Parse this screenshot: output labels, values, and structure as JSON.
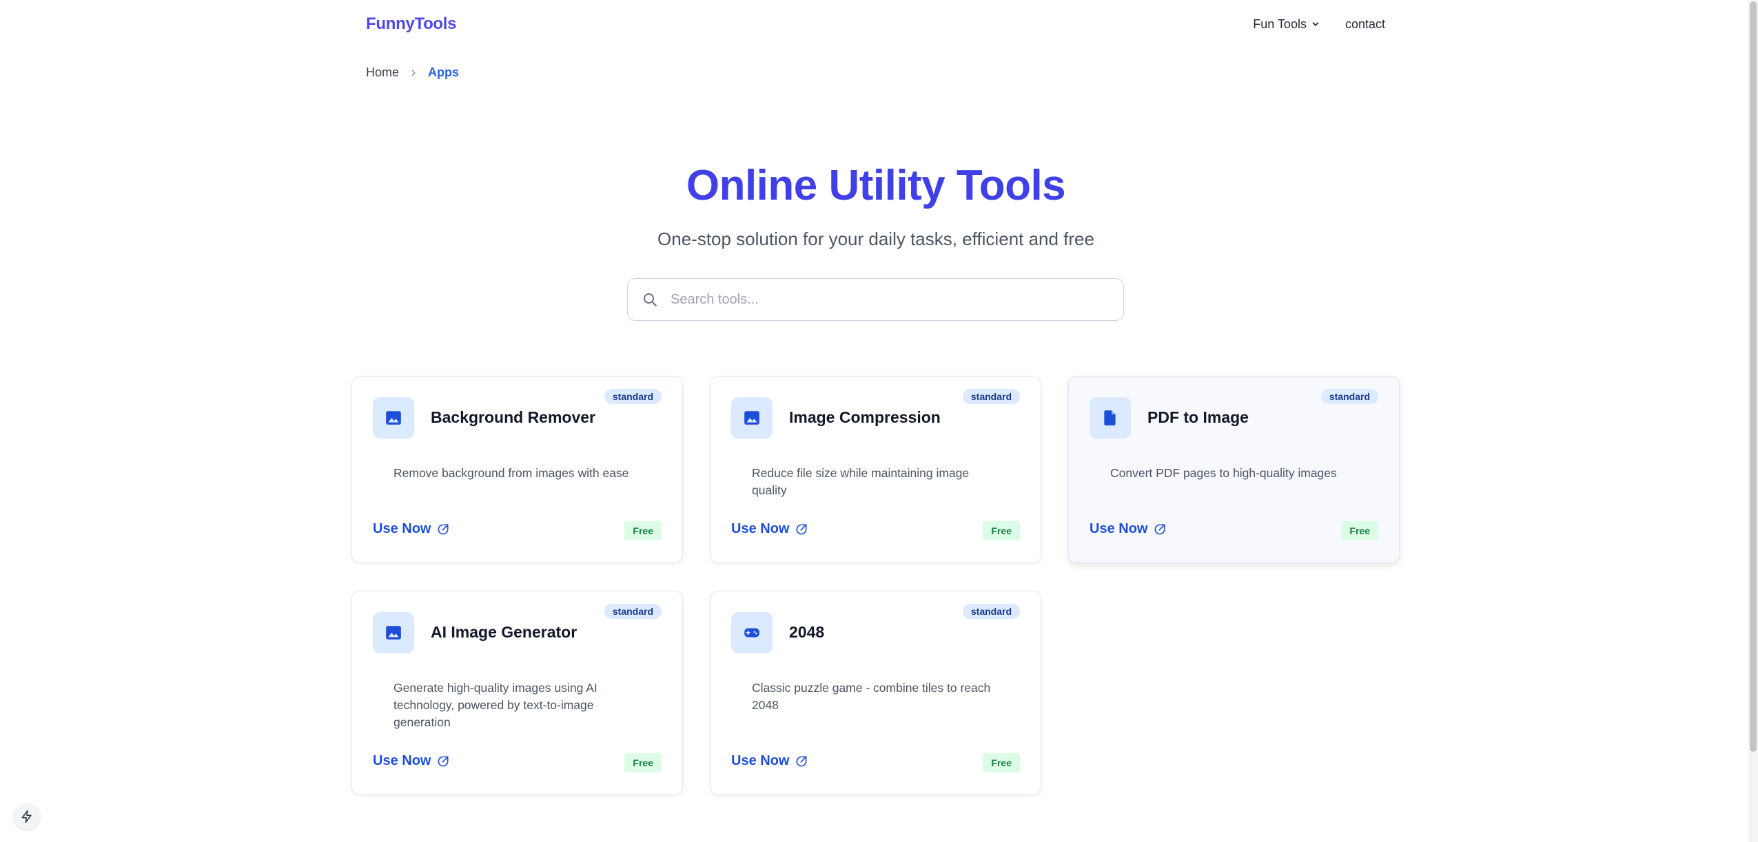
{
  "header": {
    "logo": "FunnyTools",
    "nav": {
      "fun_tools": "Fun Tools",
      "contact": "contact"
    }
  },
  "breadcrumb": {
    "home": "Home",
    "current": "Apps"
  },
  "hero": {
    "title": "Online Utility Tools",
    "subtitle": "One-stop solution for your daily tasks, efficient and free"
  },
  "search": {
    "placeholder": "Search tools...",
    "value": ""
  },
  "cards": [
    {
      "title": "Background Remover",
      "description": "Remove background from images with ease",
      "tag": "standard",
      "action": "Use Now",
      "price": "Free",
      "icon": "image-icon"
    },
    {
      "title": "Image Compression",
      "description": "Reduce file size while maintaining image quality",
      "tag": "standard",
      "action": "Use Now",
      "price": "Free",
      "icon": "image-icon"
    },
    {
      "title": "PDF to Image",
      "description": "Convert PDF pages to high-quality images",
      "tag": "standard",
      "action": "Use Now",
      "price": "Free",
      "icon": "document-icon"
    },
    {
      "title": "AI Image Generator",
      "description": "Generate high-quality images using AI technology, powered by text-to-image generation",
      "tag": "standard",
      "action": "Use Now",
      "price": "Free",
      "icon": "image-icon"
    },
    {
      "title": "2048",
      "description": "Classic puzzle game - combine tiles to reach 2048",
      "tag": "standard",
      "action": "Use Now",
      "price": "Free",
      "icon": "gamepad-icon"
    }
  ],
  "colors": {
    "brand": "#4f46e5",
    "accent": "#1d4ed8",
    "free_bg": "#dcfce7",
    "tag_bg": "#dbeafe"
  }
}
